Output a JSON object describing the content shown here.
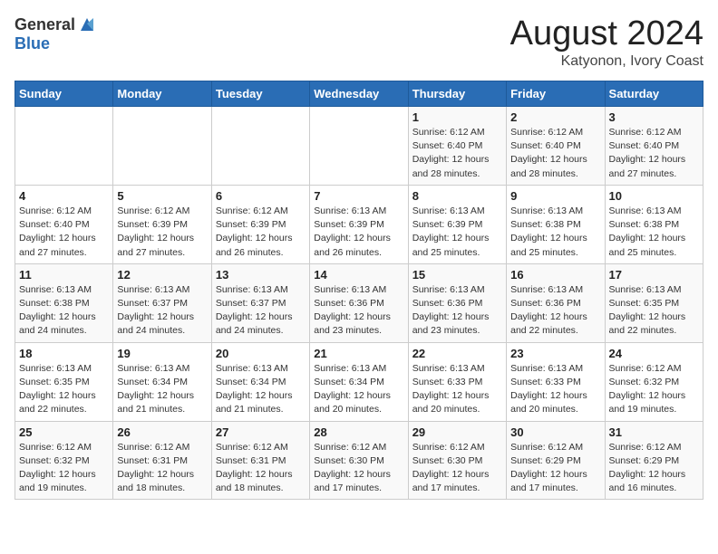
{
  "header": {
    "logo_general": "General",
    "logo_blue": "Blue",
    "month_title": "August 2024",
    "location": "Katyonon, Ivory Coast"
  },
  "days_of_week": [
    "Sunday",
    "Monday",
    "Tuesday",
    "Wednesday",
    "Thursday",
    "Friday",
    "Saturday"
  ],
  "weeks": [
    [
      {
        "day": "",
        "detail": ""
      },
      {
        "day": "",
        "detail": ""
      },
      {
        "day": "",
        "detail": ""
      },
      {
        "day": "",
        "detail": ""
      },
      {
        "day": "1",
        "detail": "Sunrise: 6:12 AM\nSunset: 6:40 PM\nDaylight: 12 hours\nand 28 minutes."
      },
      {
        "day": "2",
        "detail": "Sunrise: 6:12 AM\nSunset: 6:40 PM\nDaylight: 12 hours\nand 28 minutes."
      },
      {
        "day": "3",
        "detail": "Sunrise: 6:12 AM\nSunset: 6:40 PM\nDaylight: 12 hours\nand 27 minutes."
      }
    ],
    [
      {
        "day": "4",
        "detail": "Sunrise: 6:12 AM\nSunset: 6:40 PM\nDaylight: 12 hours\nand 27 minutes."
      },
      {
        "day": "5",
        "detail": "Sunrise: 6:12 AM\nSunset: 6:39 PM\nDaylight: 12 hours\nand 27 minutes."
      },
      {
        "day": "6",
        "detail": "Sunrise: 6:12 AM\nSunset: 6:39 PM\nDaylight: 12 hours\nand 26 minutes."
      },
      {
        "day": "7",
        "detail": "Sunrise: 6:13 AM\nSunset: 6:39 PM\nDaylight: 12 hours\nand 26 minutes."
      },
      {
        "day": "8",
        "detail": "Sunrise: 6:13 AM\nSunset: 6:39 PM\nDaylight: 12 hours\nand 25 minutes."
      },
      {
        "day": "9",
        "detail": "Sunrise: 6:13 AM\nSunset: 6:38 PM\nDaylight: 12 hours\nand 25 minutes."
      },
      {
        "day": "10",
        "detail": "Sunrise: 6:13 AM\nSunset: 6:38 PM\nDaylight: 12 hours\nand 25 minutes."
      }
    ],
    [
      {
        "day": "11",
        "detail": "Sunrise: 6:13 AM\nSunset: 6:38 PM\nDaylight: 12 hours\nand 24 minutes."
      },
      {
        "day": "12",
        "detail": "Sunrise: 6:13 AM\nSunset: 6:37 PM\nDaylight: 12 hours\nand 24 minutes."
      },
      {
        "day": "13",
        "detail": "Sunrise: 6:13 AM\nSunset: 6:37 PM\nDaylight: 12 hours\nand 24 minutes."
      },
      {
        "day": "14",
        "detail": "Sunrise: 6:13 AM\nSunset: 6:36 PM\nDaylight: 12 hours\nand 23 minutes."
      },
      {
        "day": "15",
        "detail": "Sunrise: 6:13 AM\nSunset: 6:36 PM\nDaylight: 12 hours\nand 23 minutes."
      },
      {
        "day": "16",
        "detail": "Sunrise: 6:13 AM\nSunset: 6:36 PM\nDaylight: 12 hours\nand 22 minutes."
      },
      {
        "day": "17",
        "detail": "Sunrise: 6:13 AM\nSunset: 6:35 PM\nDaylight: 12 hours\nand 22 minutes."
      }
    ],
    [
      {
        "day": "18",
        "detail": "Sunrise: 6:13 AM\nSunset: 6:35 PM\nDaylight: 12 hours\nand 22 minutes."
      },
      {
        "day": "19",
        "detail": "Sunrise: 6:13 AM\nSunset: 6:34 PM\nDaylight: 12 hours\nand 21 minutes."
      },
      {
        "day": "20",
        "detail": "Sunrise: 6:13 AM\nSunset: 6:34 PM\nDaylight: 12 hours\nand 21 minutes."
      },
      {
        "day": "21",
        "detail": "Sunrise: 6:13 AM\nSunset: 6:34 PM\nDaylight: 12 hours\nand 20 minutes."
      },
      {
        "day": "22",
        "detail": "Sunrise: 6:13 AM\nSunset: 6:33 PM\nDaylight: 12 hours\nand 20 minutes."
      },
      {
        "day": "23",
        "detail": "Sunrise: 6:13 AM\nSunset: 6:33 PM\nDaylight: 12 hours\nand 20 minutes."
      },
      {
        "day": "24",
        "detail": "Sunrise: 6:12 AM\nSunset: 6:32 PM\nDaylight: 12 hours\nand 19 minutes."
      }
    ],
    [
      {
        "day": "25",
        "detail": "Sunrise: 6:12 AM\nSunset: 6:32 PM\nDaylight: 12 hours\nand 19 minutes."
      },
      {
        "day": "26",
        "detail": "Sunrise: 6:12 AM\nSunset: 6:31 PM\nDaylight: 12 hours\nand 18 minutes."
      },
      {
        "day": "27",
        "detail": "Sunrise: 6:12 AM\nSunset: 6:31 PM\nDaylight: 12 hours\nand 18 minutes."
      },
      {
        "day": "28",
        "detail": "Sunrise: 6:12 AM\nSunset: 6:30 PM\nDaylight: 12 hours\nand 17 minutes."
      },
      {
        "day": "29",
        "detail": "Sunrise: 6:12 AM\nSunset: 6:30 PM\nDaylight: 12 hours\nand 17 minutes."
      },
      {
        "day": "30",
        "detail": "Sunrise: 6:12 AM\nSunset: 6:29 PM\nDaylight: 12 hours\nand 17 minutes."
      },
      {
        "day": "31",
        "detail": "Sunrise: 6:12 AM\nSunset: 6:29 PM\nDaylight: 12 hours\nand 16 minutes."
      }
    ]
  ]
}
